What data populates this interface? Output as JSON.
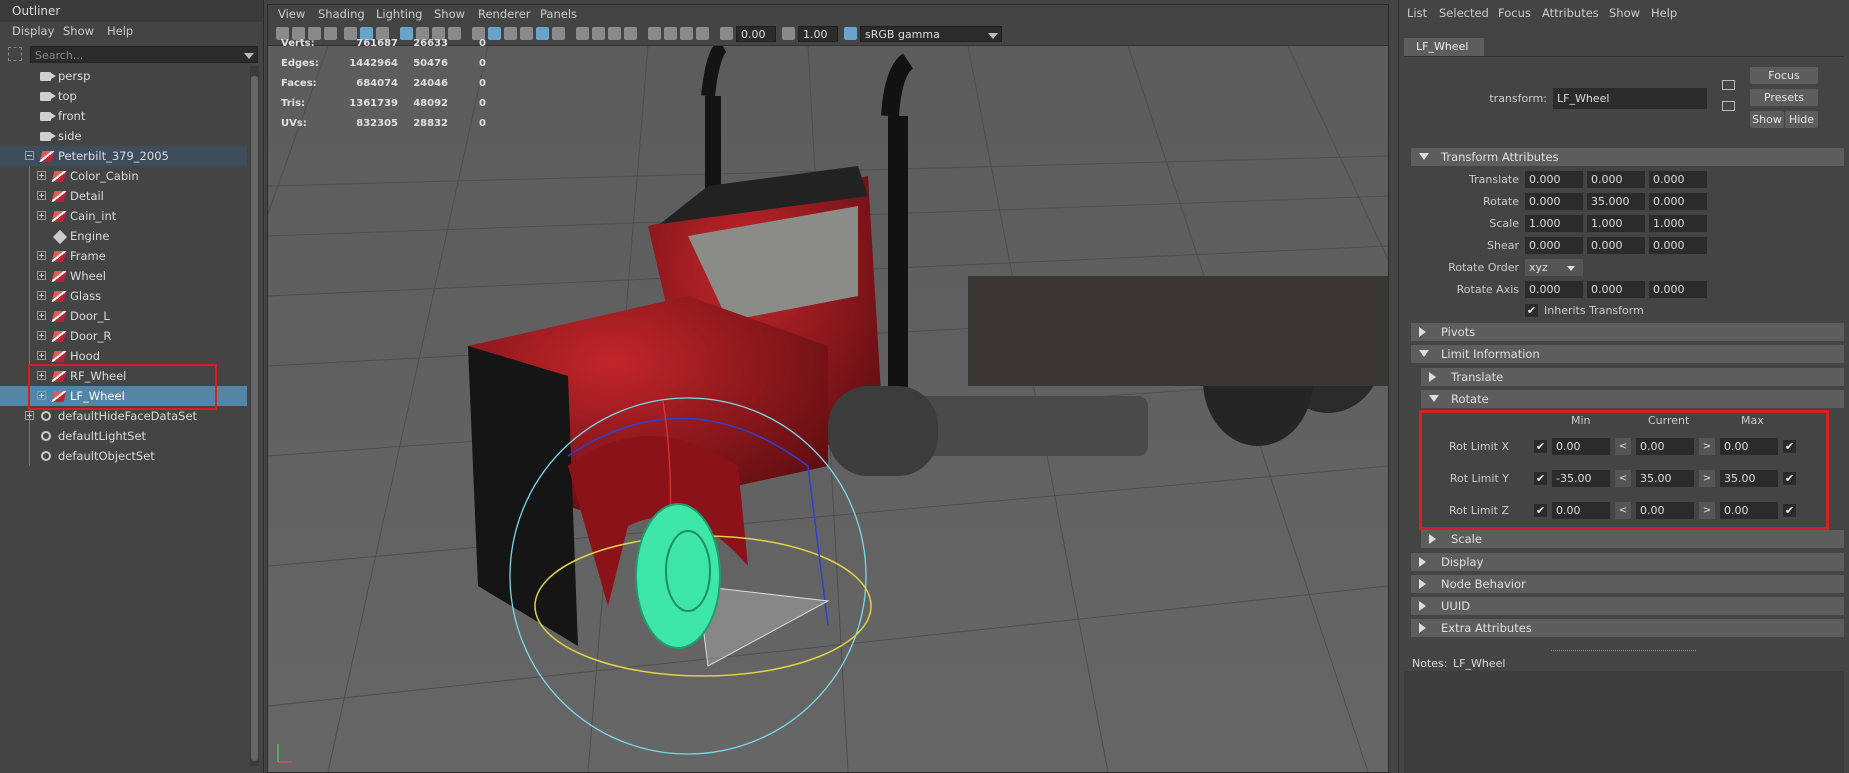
{
  "outliner": {
    "title": "Outliner",
    "menu": [
      "Display",
      "Show",
      "Help"
    ],
    "search_placeholder": "Search...",
    "items": [
      {
        "label": "persp"
      },
      {
        "label": "top"
      },
      {
        "label": "front"
      },
      {
        "label": "side"
      },
      {
        "label": "Peterbilt_379_2005"
      },
      {
        "label": "Color_Cabin"
      },
      {
        "label": "Detail"
      },
      {
        "label": "Cain_int"
      },
      {
        "label": "Engine"
      },
      {
        "label": "Frame"
      },
      {
        "label": "Wheel"
      },
      {
        "label": "Glass"
      },
      {
        "label": "Door_L"
      },
      {
        "label": "Door_R"
      },
      {
        "label": "Hood"
      },
      {
        "label": "RF_Wheel"
      },
      {
        "label": "LF_Wheel"
      },
      {
        "label": "defaultHideFaceDataSet"
      },
      {
        "label": "defaultLightSet"
      },
      {
        "label": "defaultObjectSet"
      }
    ]
  },
  "viewport": {
    "menu": [
      "View",
      "Shading",
      "Lighting",
      "Show",
      "Renderer",
      "Panels"
    ],
    "exposure": "0.00",
    "gamma": "1.00",
    "colorspace": "sRGB gamma",
    "hud": [
      {
        "label": "Verts:",
        "v1": "761687",
        "v2": "26633",
        "v3": "0"
      },
      {
        "label": "Edges:",
        "v1": "1442964",
        "v2": "50476",
        "v3": "0"
      },
      {
        "label": "Faces:",
        "v1": "684074",
        "v2": "24046",
        "v3": "0"
      },
      {
        "label": "Tris:",
        "v1": "1361739",
        "v2": "48092",
        "v3": "0"
      },
      {
        "label": "UVs:",
        "v1": "832305",
        "v2": "28832",
        "v3": "0"
      }
    ]
  },
  "attr": {
    "menu": [
      "List",
      "Selected",
      "Focus",
      "Attributes",
      "Show",
      "Help"
    ],
    "tab": "LF_Wheel",
    "transform_label": "transform:",
    "transform_value": "LF_Wheel",
    "buttons": {
      "focus": "Focus",
      "presets": "Presets",
      "show": "Show",
      "hide": "Hide"
    },
    "sections": {
      "transform": "Transform Attributes",
      "pivots": "Pivots",
      "limit": "Limit Information",
      "translate": "Translate",
      "rotate": "Rotate",
      "scale": "Scale",
      "display": "Display",
      "node_behavior": "Node Behavior",
      "uuid": "UUID",
      "extra": "Extra Attributes"
    },
    "transform_rows": [
      {
        "label": "Translate",
        "v": [
          "0.000",
          "0.000",
          "0.000"
        ]
      },
      {
        "label": "Rotate",
        "v": [
          "0.000",
          "35.000",
          "0.000"
        ]
      },
      {
        "label": "Scale",
        "v": [
          "1.000",
          "1.000",
          "1.000"
        ]
      },
      {
        "label": "Shear",
        "v": [
          "0.000",
          "0.000",
          "0.000"
        ]
      }
    ],
    "rotate_order_label": "Rotate Order",
    "rotate_order_value": "xyz",
    "rotate_axis_label": "Rotate Axis",
    "rotate_axis": [
      "0.000",
      "0.000",
      "0.000"
    ],
    "inherits_label": "Inherits Transform",
    "limit_headers": {
      "min": "Min",
      "current": "Current",
      "max": "Max"
    },
    "limits": [
      {
        "label": "Rot Limit X",
        "min": "0.00",
        "cur": "0.00",
        "max": "0.00"
      },
      {
        "label": "Rot Limit Y",
        "min": "-35.00",
        "cur": "35.00",
        "max": "35.00"
      },
      {
        "label": "Rot Limit Z",
        "min": "0.00",
        "cur": "0.00",
        "max": "0.00"
      }
    ],
    "notes_label": "Notes:",
    "notes_value": "LF_Wheel",
    "check_glyph": "✔",
    "less_glyph": "<",
    "greater_glyph": ">"
  }
}
